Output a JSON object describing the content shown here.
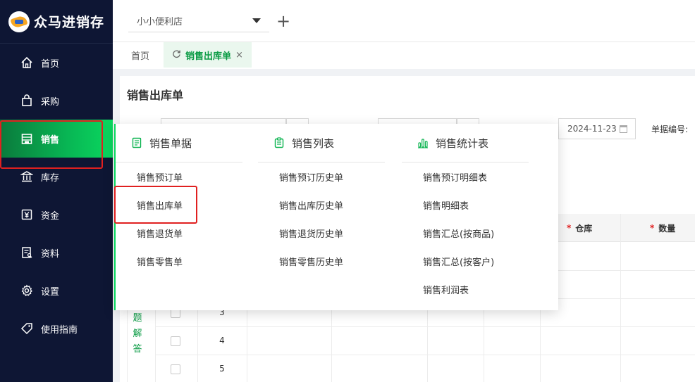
{
  "app": {
    "name": "众马进销存"
  },
  "sidebar": {
    "items": [
      {
        "label": "首页",
        "icon": "home-icon"
      },
      {
        "label": "采购",
        "icon": "shopping-bag-icon"
      },
      {
        "label": "销售",
        "icon": "store-icon",
        "active": true
      },
      {
        "label": "库存",
        "icon": "warehouse-icon"
      },
      {
        "label": "资金",
        "icon": "money-icon"
      },
      {
        "label": "资料",
        "icon": "document-icon"
      },
      {
        "label": "设置",
        "icon": "gear-icon"
      },
      {
        "label": "使用指南",
        "icon": "tag-icon"
      }
    ]
  },
  "topbar": {
    "store_value": "小小便利店",
    "add_label": "+"
  },
  "tabs": {
    "home": "首页",
    "active": "销售出库单",
    "close": "×"
  },
  "page": {
    "title": "销售出库单",
    "date_value": "2024-11-23",
    "doc_no_label": "单据编号:"
  },
  "table": {
    "headers": {
      "warehouse": "仓库",
      "quantity": "数量"
    },
    "row_numbers": [
      "3",
      "4",
      "5"
    ],
    "help_text": [
      "题",
      "解",
      "答"
    ]
  },
  "dropdown": {
    "columns": [
      {
        "title": "销售单据",
        "icon": "doc-list-icon",
        "items": [
          "销售预订单",
          "销售出库单",
          "销售退货单",
          "销售零售单"
        ]
      },
      {
        "title": "销售列表",
        "icon": "clipboard-icon",
        "items": [
          "销售预订历史单",
          "销售出库历史单",
          "销售退货历史单",
          "销售零售历史单"
        ]
      },
      {
        "title": "销售统计表",
        "icon": "bar-chart-icon",
        "items": [
          "销售预订明细表",
          "销售明细表",
          "销售汇总(按商品)",
          "销售汇总(按客户)",
          "销售利润表"
        ]
      }
    ]
  },
  "colors": {
    "accent": "#0ab34f",
    "sidebar_bg": "#0e1634",
    "highlight_box": "#e02020"
  }
}
